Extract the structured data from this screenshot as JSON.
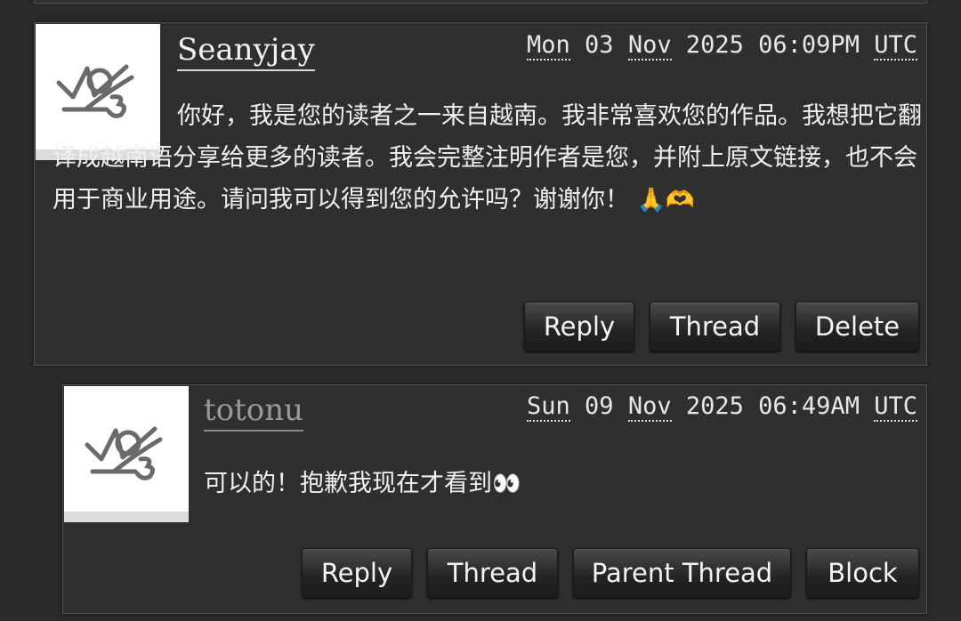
{
  "comments": [
    {
      "username": "Seanyjay",
      "timestamp": {
        "day": "Mon",
        "date": "03",
        "month": "Nov",
        "year": "2025",
        "time": "06:09PM",
        "tz": "UTC"
      },
      "body": "你好，我是您的读者之一来自越南。我非常喜欢您的作品。我想把它翻译成越南语分享给更多的读者。我会完整注明作者是您，并附上原文链接，也不会用于商业用途。请问我可以得到您的允许吗？谢谢你！",
      "emojis": "🙏🫶",
      "buttons": [
        "Reply",
        "Thread",
        "Delete"
      ]
    },
    {
      "username": "totonu",
      "timestamp": {
        "day": "Sun",
        "date": "09",
        "month": "Nov",
        "year": "2025",
        "time": "06:49AM",
        "tz": "UTC"
      },
      "body": "可以的！抱歉我现在才看到",
      "emojis": "👀",
      "buttons": [
        "Reply",
        "Thread",
        "Parent Thread",
        "Block"
      ]
    }
  ],
  "colors": {
    "background": "#2a2a2a",
    "panel": "#2f2f2f",
    "text": "#e8e8e8",
    "muted_username": "#9a9a9a"
  },
  "icons": {
    "avatar": "default-userpic-icon"
  }
}
